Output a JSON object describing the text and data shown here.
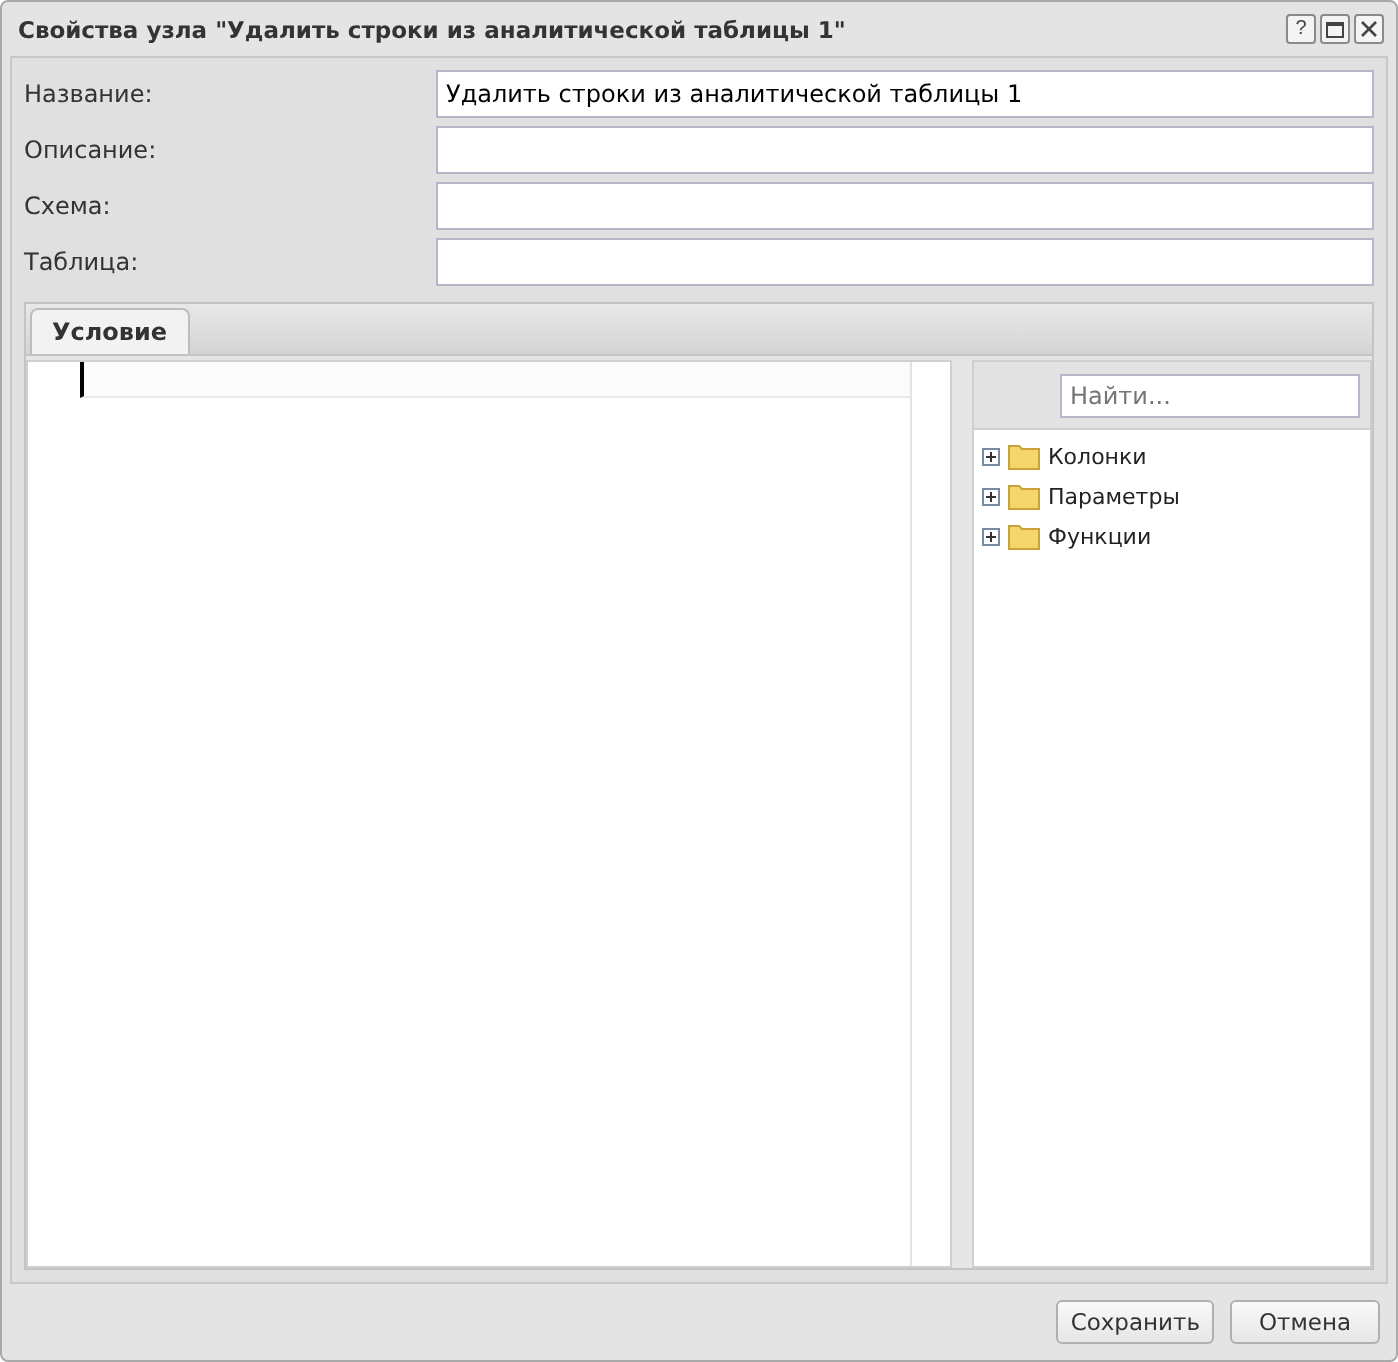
{
  "window": {
    "title": "Свойства узла \"Удалить строки из аналитической таблицы 1\"",
    "tools": [
      "?"
    ]
  },
  "fields": [
    {
      "label": "Название:",
      "value": "Удалить строки из аналитической таблицы 1"
    },
    {
      "label": "Описание:"
    },
    {
      "label": "Схема:"
    },
    {
      "label": "Таблица:"
    }
  ],
  "tabs": [
    {
      "label": "Условие",
      "selected": true
    }
  ],
  "search": {
    "placeholder": "Найти..."
  },
  "tree": [
    {
      "label": "Колонки",
      "expanded": false
    },
    {
      "label": "Параметры",
      "expanded": false
    },
    {
      "label": "Функции",
      "expanded": false
    }
  ],
  "buttons": [
    "Сохранить",
    "Отмена"
  ]
}
